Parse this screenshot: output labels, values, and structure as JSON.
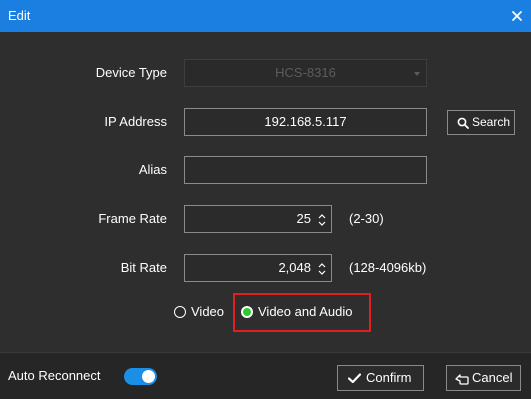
{
  "dialog": {
    "title": "Edit"
  },
  "form": {
    "device_type": {
      "label": "Device Type",
      "value": "HCS-8316"
    },
    "ip_address": {
      "label": "IP Address",
      "value": "192.168.5.117"
    },
    "search_button": {
      "label": "Search"
    },
    "alias": {
      "label": "Alias",
      "value": ""
    },
    "frame_rate": {
      "label": "Frame Rate",
      "value": "25",
      "range": "(2-30)"
    },
    "bit_rate": {
      "label": "Bit Rate",
      "value": "2,048",
      "range": "(128-4096kb)"
    },
    "stream": {
      "options": [
        "Video",
        "Video and Audio"
      ],
      "selected": "Video and Audio"
    }
  },
  "footer": {
    "auto_reconnect": {
      "label": "Auto Reconnect",
      "enabled": true
    },
    "confirm_label": "Confirm",
    "cancel_label": "Cancel"
  },
  "colors": {
    "title_bar": "#1a7fe0",
    "toggle_on": "#1a8fe8",
    "radio_checked": "#2bcb2b",
    "highlight": "#e0201f"
  }
}
